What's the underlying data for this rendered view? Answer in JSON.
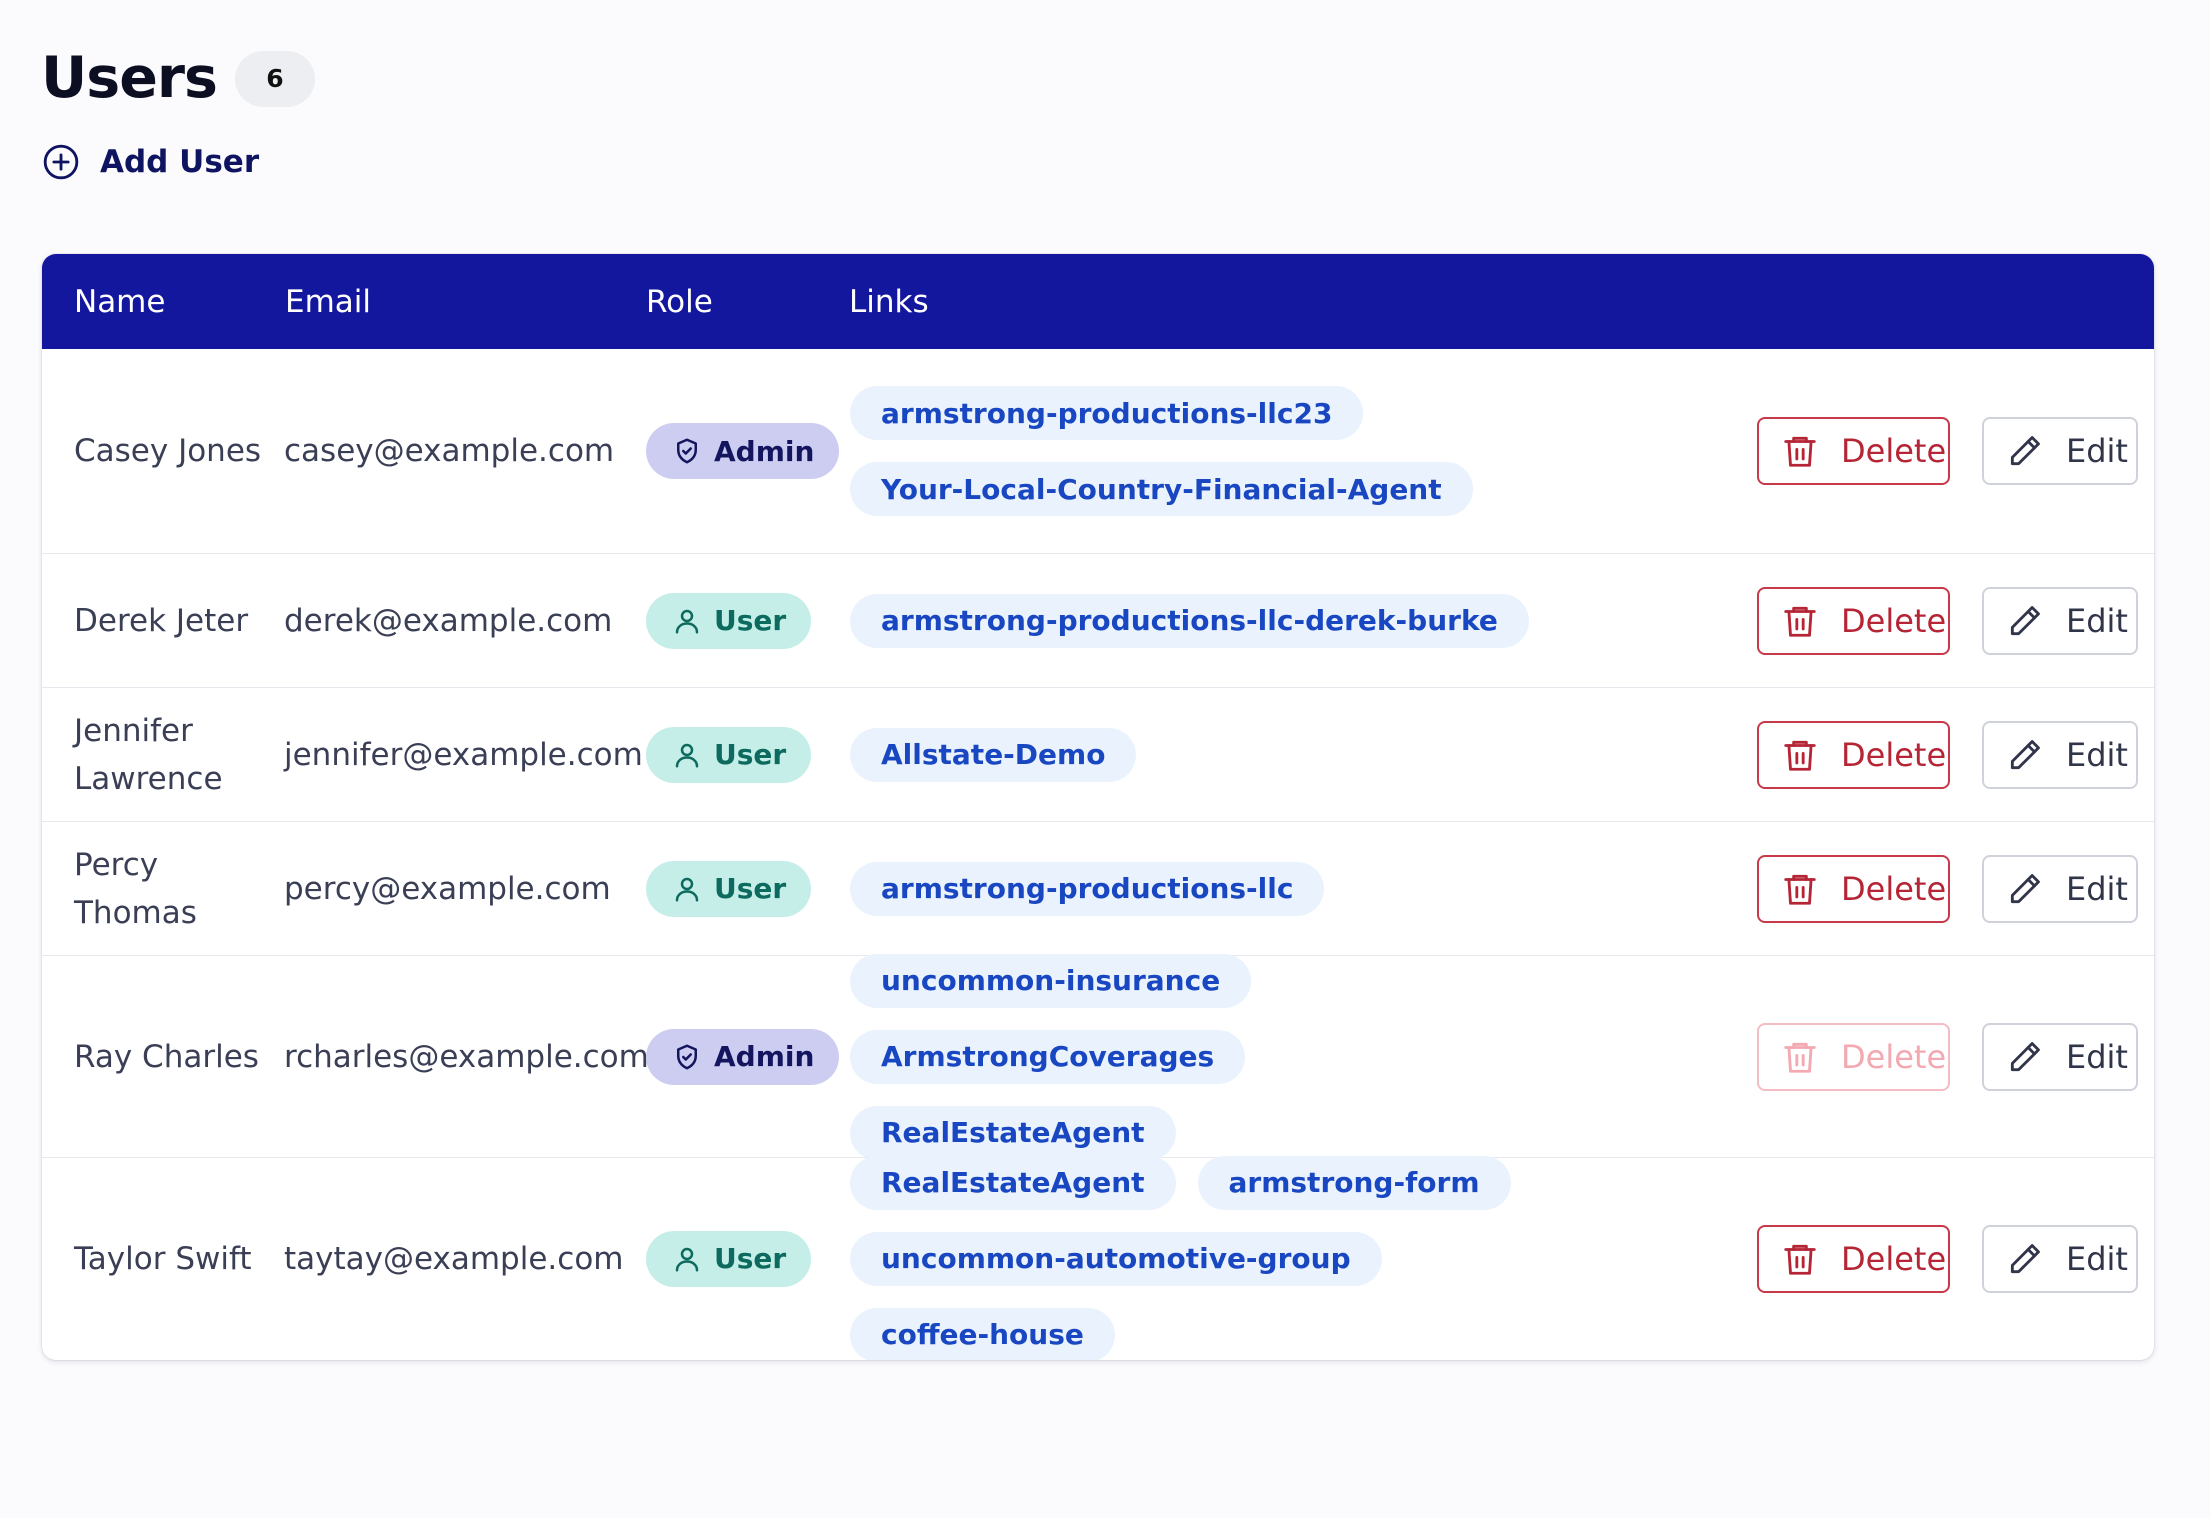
{
  "page": {
    "title": "Users",
    "count": "6",
    "add_user_label": "Add User"
  },
  "table": {
    "columns": [
      "Name",
      "Email",
      "Role",
      "Links"
    ],
    "delete_label": "Delete",
    "edit_label": "Edit",
    "rows": [
      {
        "name": "Casey Jones",
        "email": "casey@example.com",
        "role": "Admin",
        "links": [
          "armstrong-productions-llc23",
          "Your-Local-Country-Financial-Agent"
        ],
        "delete_disabled": false
      },
      {
        "name": "Derek Jeter",
        "email": "derek@example.com",
        "role": "User",
        "links": [
          "armstrong-productions-llc-derek-burke"
        ],
        "delete_disabled": false
      },
      {
        "name": "Jennifer Lawrence",
        "email": "jennifer@example.com",
        "role": "User",
        "links": [
          "Allstate-Demo"
        ],
        "delete_disabled": false
      },
      {
        "name": "Percy Thomas",
        "email": "percy@example.com",
        "role": "User",
        "links": [
          "armstrong-productions-llc"
        ],
        "delete_disabled": false
      },
      {
        "name": "Ray Charles",
        "email": "rcharles@example.com",
        "role": "Admin",
        "links": [
          "uncommon-insurance",
          "ArmstrongCoverages",
          "RealEstateAgent"
        ],
        "delete_disabled": true
      },
      {
        "name": "Taylor Swift",
        "email": "taytay@example.com",
        "role": "User",
        "links": [
          "RealEstateAgent",
          "armstrong-form",
          "uncommon-automotive-group",
          "coffee-house"
        ],
        "delete_disabled": false
      }
    ]
  },
  "colors": {
    "header_bg": "#13179e",
    "admin_badge_bg": "#cdcdf2",
    "user_badge_bg": "#c5eee9",
    "link_chip_bg": "#eaf3fd",
    "delete_red": "#c83a4a"
  },
  "icons": {
    "add": "plus-circle-icon",
    "admin": "shield-check-icon",
    "user": "user-icon",
    "delete": "trash-icon",
    "edit": "pencil-icon"
  }
}
